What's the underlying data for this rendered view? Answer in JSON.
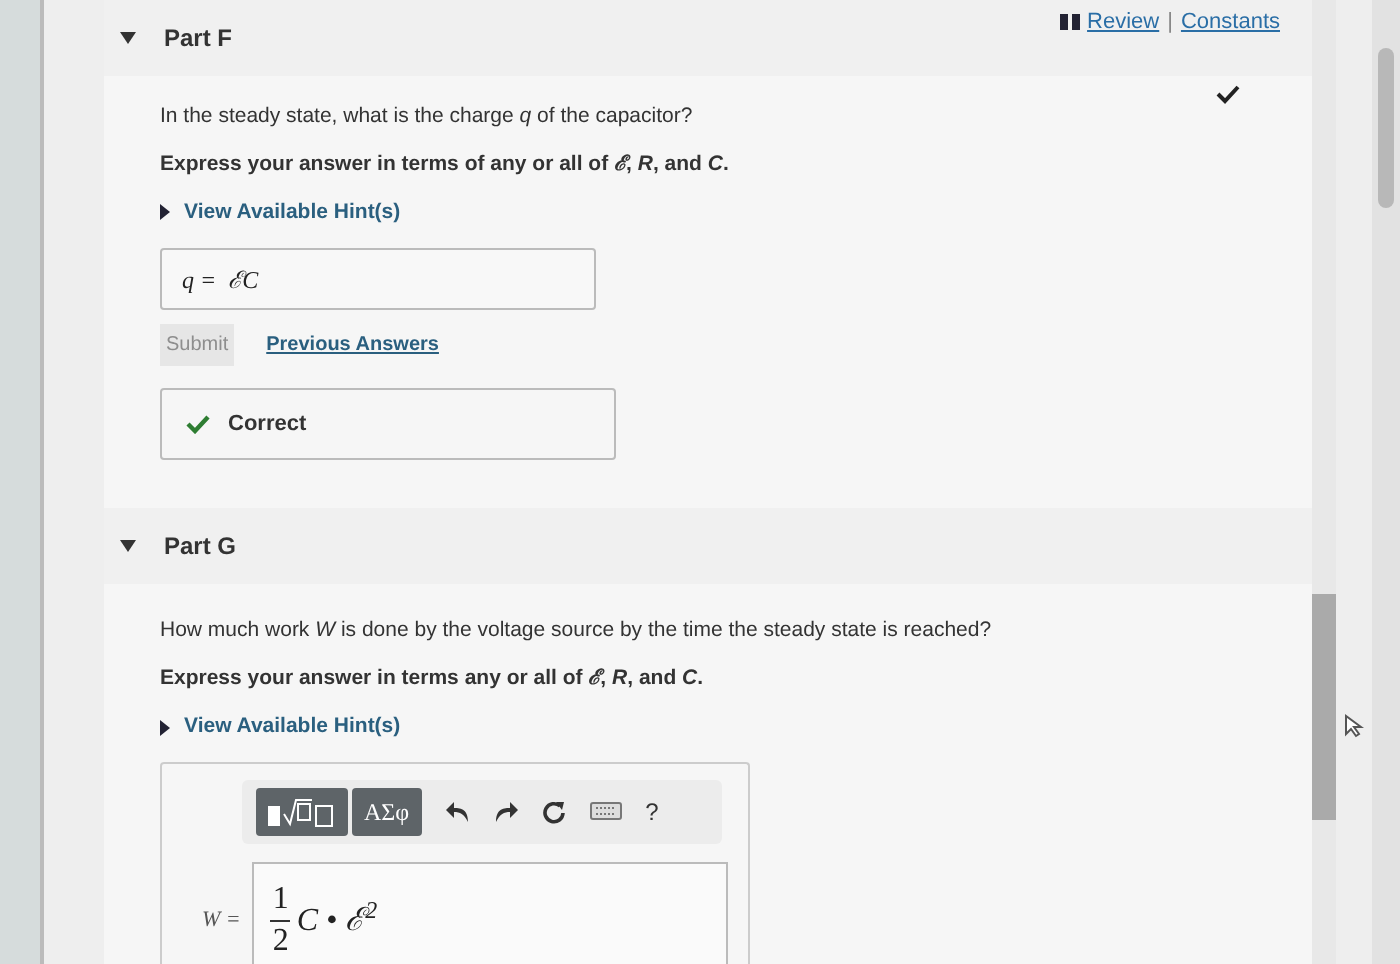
{
  "header_links": [
    {
      "label": "Review"
    },
    {
      "label": "Constants"
    }
  ],
  "link_separator": "|",
  "parts": [
    {
      "title": "Part F",
      "expanded": true,
      "completed": true,
      "question": "In the steady state, what is the charge *q* of the capacitor?",
      "instruction": "Express your answer in terms of any or all of *ℰ*, *R*, and *C*.",
      "hint_link": "View Available Hint(s)",
      "answer": {
        "kind": "plain",
        "label": "q =",
        "value": "ℰC"
      },
      "submit": {
        "label": "Submit",
        "disabled": true
      },
      "previous_answers": "Previous Answers",
      "feedback": "Correct"
    },
    {
      "title": "Part G",
      "expanded": true,
      "completed": false,
      "question": "How much work *W* is done by the voltage source by the time the steady state is reached?",
      "instruction": "Express your answer in terms any or all of *ℰ*, *R*, and *C*.",
      "hint_link": "View Available Hint(s)",
      "answer": {
        "kind": "editor",
        "toolbar": [
          {
            "kind": "templates"
          },
          {
            "kind": "text",
            "label": "ΑΣφ"
          },
          {
            "kind": "undo"
          },
          {
            "kind": "redo"
          },
          {
            "kind": "reset"
          },
          {
            "kind": "keyboard"
          },
          {
            "kind": "plain",
            "label": "?"
          }
        ],
        "label": "W =",
        "numerator": "1",
        "denominator": "2",
        "value": "C • ℰ$^{2}$"
      }
    }
  ]
}
